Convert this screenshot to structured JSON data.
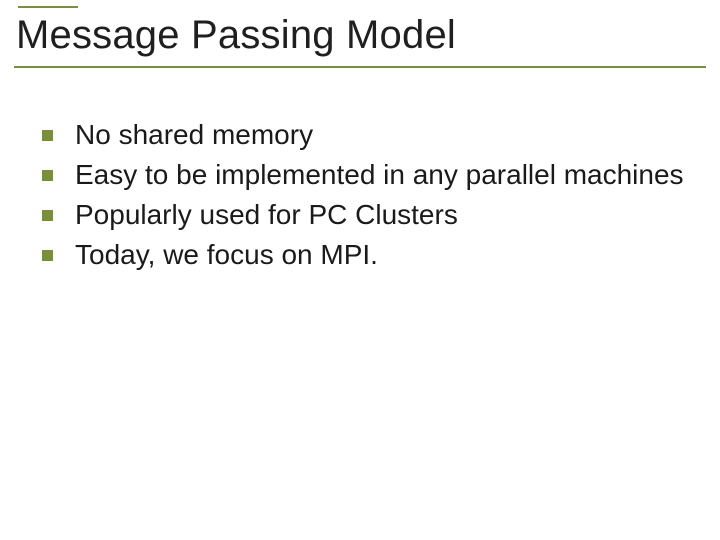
{
  "slide": {
    "title": "Message Passing Model",
    "bullets": [
      "No shared memory",
      "Easy to be implemented in any parallel machines",
      "Popularly used for PC Clusters",
      "Today, we focus on MPI."
    ]
  },
  "colors": {
    "accent": "#7a8f3e",
    "text": "#1a1a1a"
  }
}
